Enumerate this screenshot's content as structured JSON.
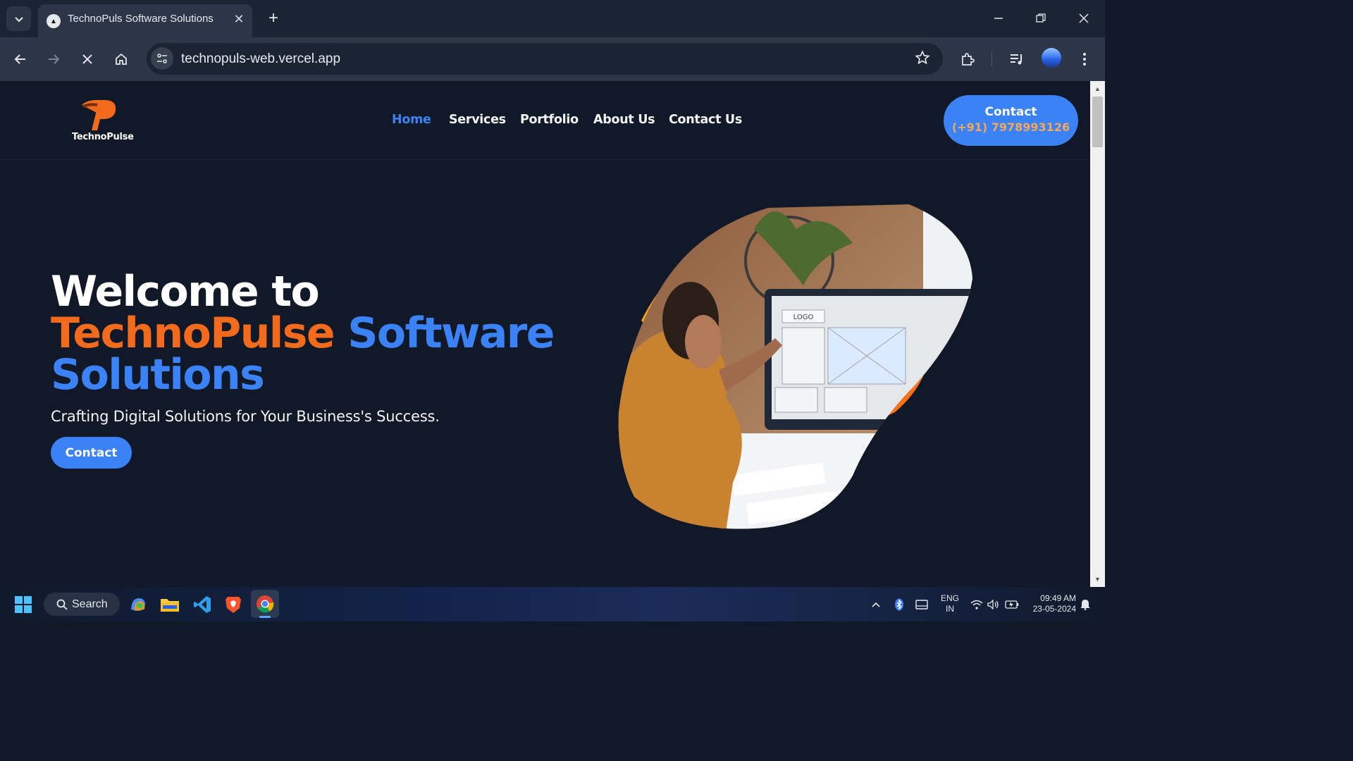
{
  "browser": {
    "tab_title": "TechnoPuls Software Solutions",
    "tab_close": "✕",
    "new_tab": "+",
    "url": "technopuls-web.vercel.app"
  },
  "site": {
    "logo_text": "TechnoPulse",
    "nav": [
      "Home",
      "Services",
      "Portfolio",
      "About Us",
      "Contact Us"
    ],
    "header_cta_line1": "Contact",
    "header_cta_line2": "(+91) 7978993126",
    "hero_line1": "Welcome to",
    "hero_brand": "TechnoPulse",
    "hero_software": "Software",
    "hero_solutions": "Solutions",
    "hero_subtitle": "Crafting Digital Solutions for Your Business's Success.",
    "hero_button": "Contact",
    "screen_logo": "LOGO"
  },
  "taskbar": {
    "search_label": "Search",
    "lang_line1": "ENG",
    "lang_line2": "IN",
    "time": "09:49 AM",
    "date": "23-05-2024"
  },
  "colors": {
    "page_bg": "#111827",
    "accent_blue": "#3b82f6",
    "accent_orange": "#f26b1d",
    "cta_phone": "#f6a85a"
  },
  "icons": [
    "tab-list-icon",
    "favicon-icon",
    "close-icon",
    "plus-icon",
    "minimize-icon",
    "restore-icon",
    "window-close-icon",
    "back-icon",
    "forward-icon",
    "stop-icon",
    "home-icon",
    "site-info-icon",
    "star-icon",
    "extensions-icon",
    "media-icon",
    "profile-icon",
    "menu-icon",
    "windows-icon",
    "search-icon",
    "copilot-icon",
    "file-explorer-icon",
    "vscode-icon",
    "brave-icon",
    "chrome-icon",
    "chevron-up-icon",
    "bluetooth-icon",
    "tablet-icon",
    "wifi-icon",
    "volume-icon",
    "battery-icon",
    "notification-icon"
  ]
}
